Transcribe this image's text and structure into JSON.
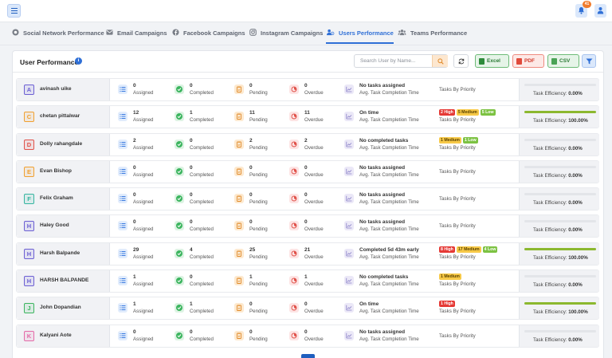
{
  "topbar": {
    "notification_count": "41"
  },
  "tabs": [
    {
      "label": "Social Network Performance",
      "icon": "network-icon",
      "active": false
    },
    {
      "label": "Email Campaigns",
      "icon": "email-icon",
      "active": false
    },
    {
      "label": "Facebook Campaigns",
      "icon": "facebook-icon",
      "active": false
    },
    {
      "label": "Instagram Campaigns",
      "icon": "instagram-icon",
      "active": false
    },
    {
      "label": "Users Performance",
      "icon": "users-icon",
      "active": true
    },
    {
      "label": "Teams Performance",
      "icon": "teams-icon",
      "active": false
    }
  ],
  "card": {
    "title": "User Performance",
    "search_placeholder": "Search User by Name...",
    "export": {
      "excel": "Excel",
      "pdf": "PDF",
      "csv": "CSV"
    }
  },
  "labels": {
    "assigned": "Assigned",
    "completed": "Completed",
    "pending": "Pending",
    "overdue": "Overdue",
    "avg_time": "Avg. Task Completion Time",
    "priority": "Tasks By Priority",
    "efficiency": "Task Efficiency:"
  },
  "colors": {
    "accent": "#2f6fd6",
    "high": "#e53935",
    "medium": "#f7c948",
    "low": "#7cc242",
    "efficiency_bar": "#8cb82f"
  },
  "users": [
    {
      "initial": "A",
      "name": "avinash uike",
      "avatar_color": "#6c5fd3",
      "assigned": "0",
      "completed": "0",
      "pending": "0",
      "overdue": "0",
      "time": "No tasks assigned",
      "badges": [],
      "efficiency": "0.00%",
      "efficiency_value": 0
    },
    {
      "initial": "C",
      "name": "chetan pittalwar",
      "avatar_color": "#f0a030",
      "assigned": "12",
      "completed": "1",
      "pending": "11",
      "overdue": "11",
      "time": "On time",
      "badges": [
        {
          "text": "2 High",
          "level": "high"
        },
        {
          "text": "5 Medium",
          "level": "med"
        },
        {
          "text": "5 Low",
          "level": "low"
        }
      ],
      "efficiency": "100.00%",
      "efficiency_value": 100
    },
    {
      "initial": "D",
      "name": "Dolly rahangdale",
      "avatar_color": "#e0524a",
      "assigned": "2",
      "completed": "0",
      "pending": "2",
      "overdue": "2",
      "time": "No completed tasks",
      "badges": [
        {
          "text": "1 Medium",
          "level": "med"
        },
        {
          "text": "1 Low",
          "level": "low"
        }
      ],
      "efficiency": "0.00%",
      "efficiency_value": 0
    },
    {
      "initial": "E",
      "name": "Evan Bishop",
      "avatar_color": "#f0a030",
      "assigned": "0",
      "completed": "0",
      "pending": "0",
      "overdue": "0",
      "time": "No tasks assigned",
      "badges": [],
      "efficiency": "0.00%",
      "efficiency_value": 0
    },
    {
      "initial": "F",
      "name": "Felix Graham",
      "avatar_color": "#35b5a0",
      "assigned": "0",
      "completed": "0",
      "pending": "0",
      "overdue": "0",
      "time": "No tasks assigned",
      "badges": [],
      "efficiency": "0.00%",
      "efficiency_value": 0
    },
    {
      "initial": "H",
      "name": "Haley Good",
      "avatar_color": "#6c5fd3",
      "assigned": "0",
      "completed": "0",
      "pending": "0",
      "overdue": "0",
      "time": "No tasks assigned",
      "badges": [],
      "efficiency": "0.00%",
      "efficiency_value": 0
    },
    {
      "initial": "H",
      "name": "Harsh Balpande",
      "avatar_color": "#6c5fd3",
      "assigned": "29",
      "completed": "4",
      "pending": "25",
      "overdue": "21",
      "time": "Completed 5d 43m early",
      "badges": [
        {
          "text": "8 High",
          "level": "high"
        },
        {
          "text": "17 Medium",
          "level": "med"
        },
        {
          "text": "4 Low",
          "level": "low"
        }
      ],
      "efficiency": "100.00%",
      "efficiency_value": 100
    },
    {
      "initial": "H",
      "name": "HARSH BALPANDE",
      "avatar_color": "#6c5fd3",
      "assigned": "1",
      "completed": "0",
      "pending": "1",
      "overdue": "1",
      "time": "No completed tasks",
      "badges": [
        {
          "text": "1 Medium",
          "level": "med"
        }
      ],
      "efficiency": "0.00%",
      "efficiency_value": 0
    },
    {
      "initial": "J",
      "name": "John Dopandian",
      "avatar_color": "#3cb55f",
      "assigned": "1",
      "completed": "1",
      "pending": "0",
      "overdue": "0",
      "time": "On time",
      "badges": [
        {
          "text": "1 High",
          "level": "high"
        }
      ],
      "efficiency": "100.00%",
      "efficiency_value": 100
    },
    {
      "initial": "K",
      "name": "Kalyani Aote",
      "avatar_color": "#e46aa8",
      "assigned": "0",
      "completed": "0",
      "pending": "0",
      "overdue": "0",
      "time": "No tasks assigned",
      "badges": [],
      "efficiency": "0.00%",
      "efficiency_value": 0
    }
  ]
}
